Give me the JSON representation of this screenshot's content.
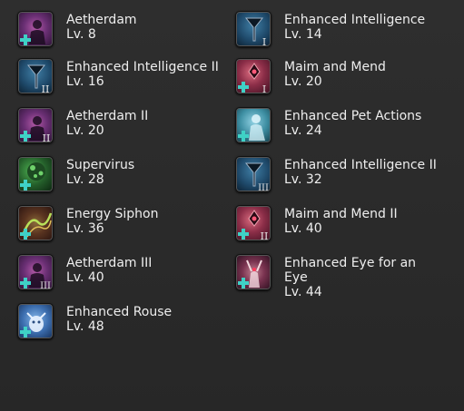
{
  "traits": [
    {
      "name": "Aetherdam",
      "level": "Lv. 8",
      "icon": "aetherdam-icon",
      "numeral": ""
    },
    {
      "name": "Enhanced Intelligence",
      "level": "Lv. 14",
      "icon": "enhanced-intelligence-icon",
      "numeral": "I"
    },
    {
      "name": "Enhanced Intelligence II",
      "level": "Lv. 16",
      "icon": "enhanced-intelligence-icon",
      "numeral": "II"
    },
    {
      "name": "Maim and Mend",
      "level": "Lv. 20",
      "icon": "maim-and-mend-icon",
      "numeral": "I"
    },
    {
      "name": "Aetherdam II",
      "level": "Lv. 20",
      "icon": "aetherdam-icon",
      "numeral": "II"
    },
    {
      "name": "Enhanced Pet Actions",
      "level": "Lv. 24",
      "icon": "enhanced-pet-actions-icon",
      "numeral": ""
    },
    {
      "name": "Supervirus",
      "level": "Lv. 28",
      "icon": "supervirus-icon",
      "numeral": ""
    },
    {
      "name": "Enhanced Intelligence II",
      "level": "Lv. 32",
      "icon": "enhanced-intelligence-icon",
      "numeral": "III"
    },
    {
      "name": "Energy Siphon",
      "level": "Lv. 36",
      "icon": "energy-siphon-icon",
      "numeral": ""
    },
    {
      "name": "Maim and Mend II",
      "level": "Lv. 40",
      "icon": "maim-and-mend-icon",
      "numeral": "II"
    },
    {
      "name": "Aetherdam III",
      "level": "Lv. 40",
      "icon": "aetherdam-icon",
      "numeral": "III"
    },
    {
      "name": "Enhanced Eye for an Eye",
      "level": "Lv. 44",
      "icon": "enhanced-eye-for-an-eye-icon",
      "numeral": ""
    },
    {
      "name": "Enhanced Rouse",
      "level": "Lv. 48",
      "icon": "enhanced-rouse-icon",
      "numeral": ""
    }
  ]
}
